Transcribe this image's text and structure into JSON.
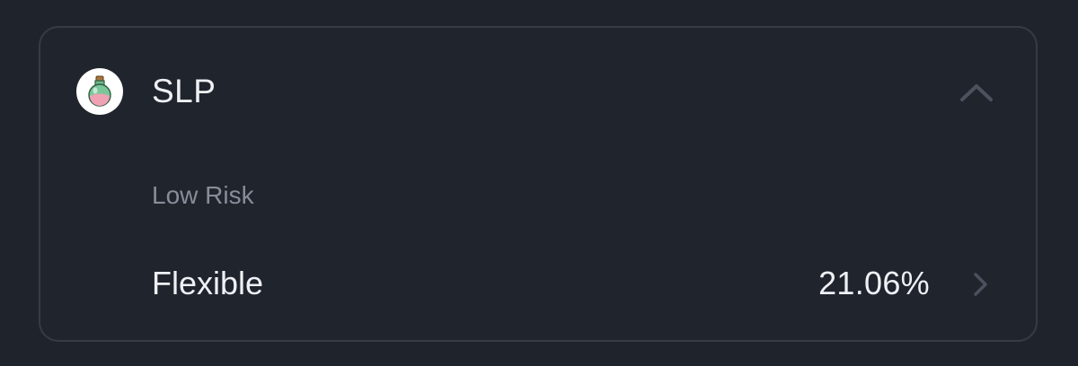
{
  "card": {
    "token": {
      "name": "SLP",
      "icon": "potion-bottle-icon"
    },
    "expanded": true,
    "risk_label": "Low Risk",
    "options": [
      {
        "label": "Flexible",
        "apr": "21.06%"
      }
    ]
  },
  "colors": {
    "background": "#1f232c",
    "border": "#363b47",
    "text_primary": "#eef0f4",
    "text_secondary": "#878d99",
    "icon_muted": "#4b515d"
  }
}
